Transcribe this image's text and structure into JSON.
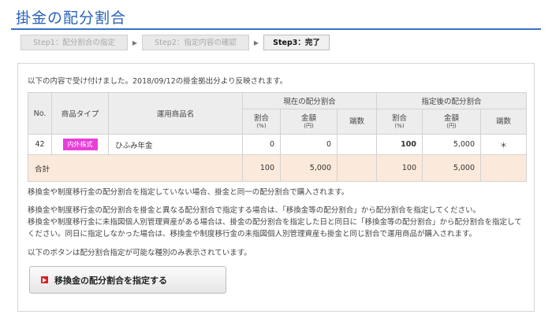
{
  "page_title": "掛金の配分割合",
  "steps": [
    {
      "label": "Step1：配分割合の指定",
      "state": "done"
    },
    {
      "label": "Step2：指定内容の確認",
      "state": "done"
    },
    {
      "label": "Step3：完了",
      "state": "active"
    }
  ],
  "intro": "以下の内容で受け付けました。2018/09/12の掛金拠出分より反映されます。",
  "table": {
    "col_no": "No.",
    "col_type": "商品タイプ",
    "col_product": "運用商品名",
    "group_current": "現在の配分割合",
    "group_new": "指定後の配分割合",
    "col_ratio": "割合",
    "col_ratio_unit": "(%)",
    "col_amount": "金額",
    "col_amount_unit": "(円)",
    "col_fraction": "端数",
    "row": {
      "no": "42",
      "type_badge": "内外株式",
      "product": "ひふみ年金",
      "current_ratio": "0",
      "current_amount": "0",
      "current_fraction": "",
      "new_ratio": "100",
      "new_amount": "5,000",
      "new_fraction": "＊"
    },
    "total": {
      "label": "合計",
      "current_ratio": "100",
      "current_amount": "5,000",
      "new_ratio": "100",
      "new_amount": "5,000"
    }
  },
  "notes": {
    "line1": "移換金や制度移行金の配分割合を指定していない場合、掛金と同一の配分割合で購入されます。",
    "line2": "移換金や制度移行金の配分割合を掛金と異なる配分割合で指定する場合は、「移換金等の配分割合」から配分割合を指定してください。",
    "line3": "移換金や制度移行金に未指図個人別管理資産がある場合は、掛金の配分割合を指定した日と同日に「移換金等の配分割合」から配分割合を指定して",
    "line4": "ください。同日に指定しなかった場合は、移換金や制度移行金の未指図個人別管理資産も掛金と同じ割合で運用商品が購入されます。",
    "line5": "以下のボタンは配分割合指定が可能な種別のみ表示されています。"
  },
  "action_button": {
    "icon": "arrow-right-icon",
    "label": "移換金の配分割合を指定する"
  },
  "colors": {
    "title": "#2a62b8",
    "badge": "#e83fd9",
    "total_row": "#fbeadb",
    "button_icon": "#d92020"
  }
}
